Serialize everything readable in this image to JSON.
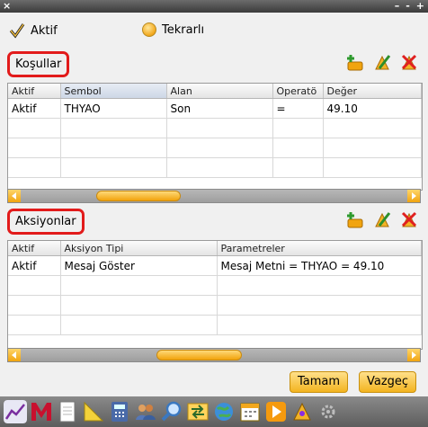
{
  "window": {
    "close_glyph": "×",
    "minimize_glyph": "–",
    "restore_glyph": "-",
    "maximize_glyph": "+"
  },
  "options": {
    "active_label": "Aktif",
    "repeat_label": "Tekrarlı"
  },
  "conditions": {
    "title": "Koşullar",
    "columns": [
      "Aktif",
      "Sembol",
      "Alan",
      "Operatö",
      "Değer"
    ],
    "rows": [
      [
        "Aktif",
        "THYAO",
        "Son",
        "=",
        "49.10"
      ]
    ],
    "scroll_position": 0.25
  },
  "actions": {
    "title": "Aksiyonlar",
    "columns": [
      "Aktif",
      "Aksiyon Tipi",
      "Parametreler"
    ],
    "rows": [
      [
        "Aktif",
        "Mesaj Göster",
        "Mesaj Metni = THYAO = 49.10"
      ]
    ],
    "scroll_position": 0.45
  },
  "buttons": {
    "ok": "Tamam",
    "cancel": "Vazgeç"
  },
  "toolbar_icons": [
    "chart-icon",
    "m-logo-icon",
    "document-icon",
    "ruler-icon",
    "calculator-icon",
    "users-icon",
    "magnifier-icon",
    "transfer-icon",
    "globe-icon",
    "calendar-icon",
    "play-icon",
    "alarm-icon",
    "gear-icon"
  ],
  "colors": {
    "accent": "#f2a71b",
    "highlight_border": "#e21b1b",
    "title_bar": "#4a4a4a"
  }
}
